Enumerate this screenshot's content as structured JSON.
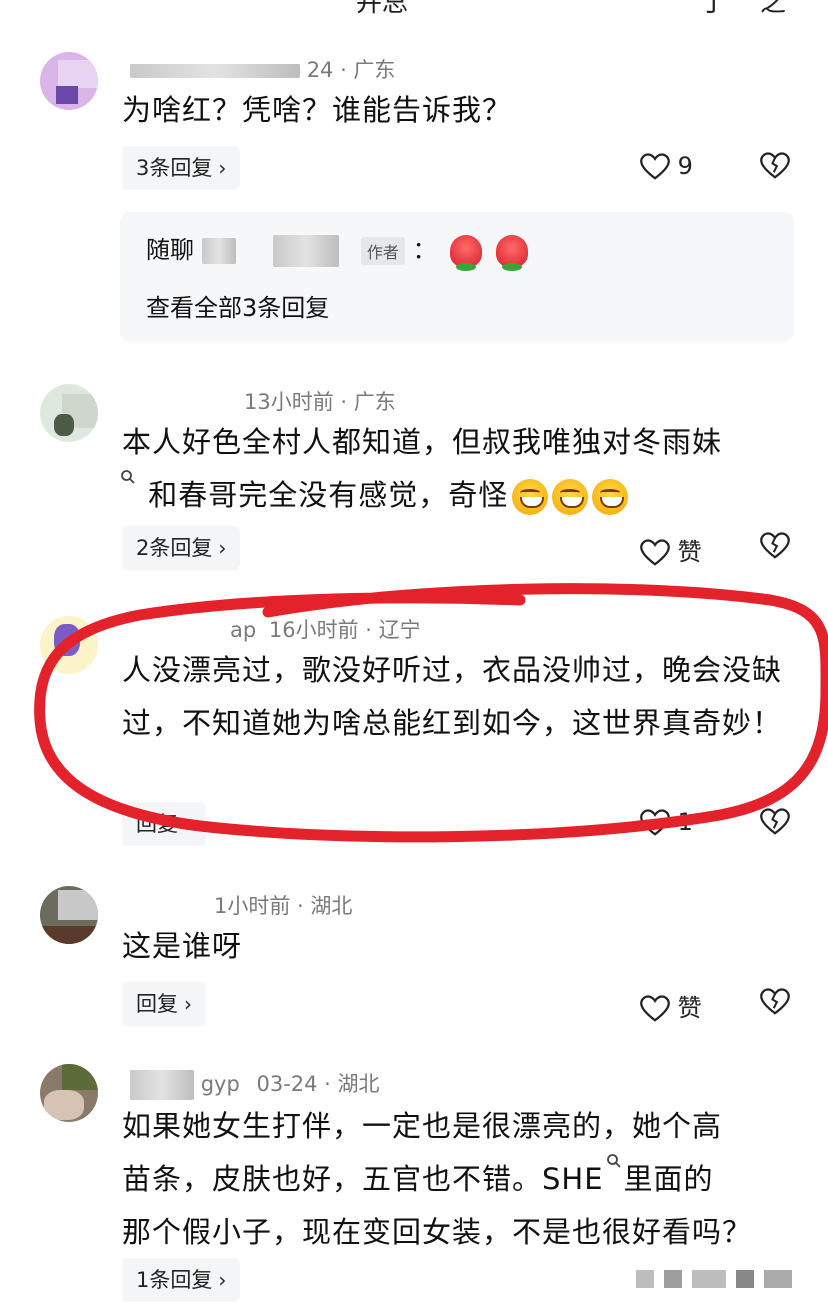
{
  "top_cut_fragments": [
    "并总",
    "丁",
    "之"
  ],
  "comments": [
    {
      "meta": "24 · 广东",
      "text": "为啥红？凭啥？谁能告诉我？",
      "reply_btn": "3条回复",
      "likes": "9",
      "sub": {
        "name": "随聊",
        "author_tag": "作者",
        "colon": "：",
        "view_all": "查看全部3条回复"
      }
    },
    {
      "meta": "13小时前 · 广东",
      "text_line1": "本人好色全村人都知道，但叔我唯独对冬雨妹",
      "text_line2": "和春哥完全没有感觉，奇怪",
      "reply_btn": "2条回复",
      "likes": "赞"
    },
    {
      "name_fragment": "ap",
      "meta": "16小时前 · 辽宁",
      "text": "人没漂亮过，歌没好听过，衣品没帅过，晚会没缺过，不知道她为啥总能红到如今，这世界真奇妙！",
      "reply_btn": "回复",
      "likes": "1"
    },
    {
      "name_fragment": "1",
      "meta": "小时前 · 湖北",
      "text": "这是谁呀",
      "reply_btn": "回复",
      "likes": "赞"
    },
    {
      "name_fragment": "gyp",
      "meta": "03-24 · 湖北",
      "text_line1": "如果她女生打伴，一定也是很漂亮的，她个高",
      "text_line2_a": "苗条，皮肤也好，五官也不错。SHE",
      "text_line2_b": "里面的",
      "text_line3": "那个假小子，现在变回女装，不是也很好看吗？",
      "reply_btn": "1条回复"
    }
  ],
  "chevron": "›",
  "icons": [
    "heart-icon",
    "broken-heart-icon",
    "search-icon",
    "laugh-emoji",
    "rose-emoji"
  ],
  "colors": {
    "annotation_red": "#e3222b",
    "reply_bg": "#f4f5f7",
    "meta_gray": "#7a7a7a"
  }
}
